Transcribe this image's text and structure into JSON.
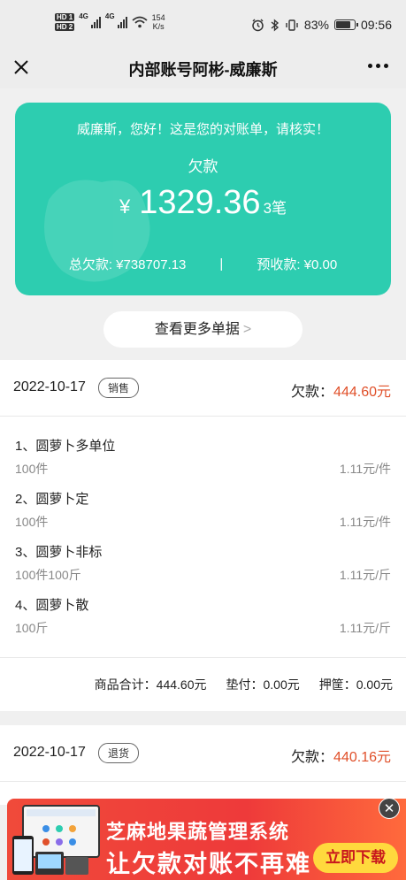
{
  "status_bar": {
    "hd1": "HD 1",
    "hd2": "HD 2",
    "net1": "4G",
    "net2": "4G",
    "speed_value": "154",
    "speed_unit": "K/s",
    "battery": "83%",
    "battery_level": 0.83,
    "time": "09:56"
  },
  "nav": {
    "title": "内部账号阿彬-威廉斯"
  },
  "card": {
    "greeting": "威廉斯，您好！这是您的对账单，请核实！",
    "owe_label": "欠款",
    "currency": "¥",
    "amount": "1329.36",
    "count": "3笔",
    "total_label": "总欠款: ¥738707.13",
    "separator": "|",
    "prepaid_label": "预收款: ¥0.00"
  },
  "more_button": {
    "label": "查看更多单据",
    "arrow": ">"
  },
  "bills": [
    {
      "date": "2022-10-17",
      "tag": "销售",
      "owe_label": "欠款：",
      "owe_value": "444.60元",
      "items": [
        {
          "name": "1、圆萝卜多单位",
          "qty": "100件",
          "price": "1.11元/件"
        },
        {
          "name": "2、圆萝卜定",
          "qty": "100件",
          "price": "1.11元/件"
        },
        {
          "name": "3、圆萝卜非标",
          "qty": "100件100斤",
          "price": "1.11元/斤"
        },
        {
          "name": "4、圆萝卜散",
          "qty": "100斤",
          "price": "1.11元/斤"
        }
      ],
      "summary": {
        "goods_total": "商品合计：444.60元",
        "advance": "垫付：0.00元",
        "deposit": "押筐：0.00元"
      }
    },
    {
      "date": "2022-10-17",
      "tag": "退货",
      "owe_label": "欠款：",
      "owe_value": "440.16元"
    }
  ],
  "ad": {
    "title": "芝麻地果蔬管理系统",
    "subtitle": "让欠款对账不再难",
    "button": "立即下载",
    "close": "✕"
  },
  "colors": {
    "card_green": "#2dcdb0",
    "owe_red": "#e0502a",
    "ad_red": "#ee3a3a",
    "ad_button": "#ffd93d"
  }
}
